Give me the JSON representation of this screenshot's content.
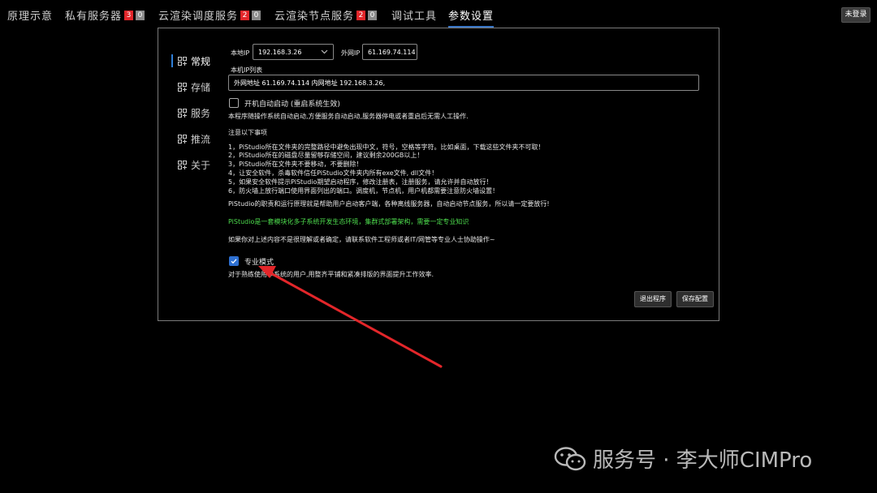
{
  "nav": {
    "tabs": [
      {
        "label": "原理示意"
      },
      {
        "label": "私有服务器",
        "badge_red": "3",
        "badge_gray": "0"
      },
      {
        "label": "云渲染调度服务",
        "badge_red": "2",
        "badge_gray": "0"
      },
      {
        "label": "云渲染节点服务",
        "badge_red": "2",
        "badge_gray": "0"
      },
      {
        "label": "调试工具"
      },
      {
        "label": "参数设置",
        "active": true
      }
    ],
    "login_label": "未登录"
  },
  "sidebar": {
    "items": [
      {
        "label": "常规",
        "icon": "grid-plus-icon",
        "active": true
      },
      {
        "label": "存储",
        "icon": "grid-plus-icon"
      },
      {
        "label": "服务",
        "icon": "grid-plus-icon"
      },
      {
        "label": "推流",
        "icon": "grid-plus-icon"
      },
      {
        "label": "关于",
        "icon": "grid-plus-icon"
      }
    ]
  },
  "general": {
    "local_ip_label": "本地IP",
    "local_ip_value": "192.168.3.26",
    "public_ip_label": "外网IP",
    "public_ip_value": "61.169.74.114",
    "ip_list_label": "本机IP列表",
    "ip_list_value": "外网地址 61.169.74.114   内网地址 192.168.3.26,",
    "autostart_label": "开机自动启动 (重启系统生效)",
    "autostart_checked": false,
    "autostart_desc": "本程序随操作系统自动启动,方便服务自动启动,服务器停电或者重启后无需人工操作.",
    "notes_title": "注意以下事项",
    "notes": [
      "1，PiStudio所在文件夹的完整路径中避免出现中文，符号，空格等字符。比如桌面，下载这些文件夹不可取！",
      "2，PiStudio所在的磁盘尽量留够存储空间，建议剩余200GB以上！",
      "3，PiStudio所在文件夹不要移动，不要删除！",
      "4，让安全软件，杀毒软件信任PiStudio文件夹内所有exe文件, dll文件！",
      "5，如果安全软件提示PiStudio期望启动程序，修改注册表，注册服务，请允许并自动放行！",
      "6，防火墙上放行端口使用界面列出的端口。调度机，节点机，用户机都需要注意防火墙设置！"
    ],
    "role_text": "PiStudio的职责和运行原理就是帮助用户启动客户端，各种离线服务器，自动启动节点服务，所以请一定要放行!",
    "green_text": "PiStudio是一套模块化多子系统开发生态环境，集群式部署架构，需要一定专业知识",
    "help_text": "如果你对上述内容不是很理解或者确定，请联系软件工程师或者IT/网管等专业人士协助操作~",
    "pro_label": "专业模式",
    "pro_checked": true,
    "pro_desc": "对于熟练使用本系统的用户,用整齐平铺和紧凑排版的界面提升工作效率."
  },
  "buttons": {
    "exit": "退出程序",
    "save": "保存配置"
  },
  "watermark": {
    "text": "服务号 · 李大师CIMPro"
  },
  "colors": {
    "accent": "#2d6fd0",
    "badge_red": "#e3262a",
    "green": "#4ede4e",
    "arrow": "#e3262a"
  }
}
